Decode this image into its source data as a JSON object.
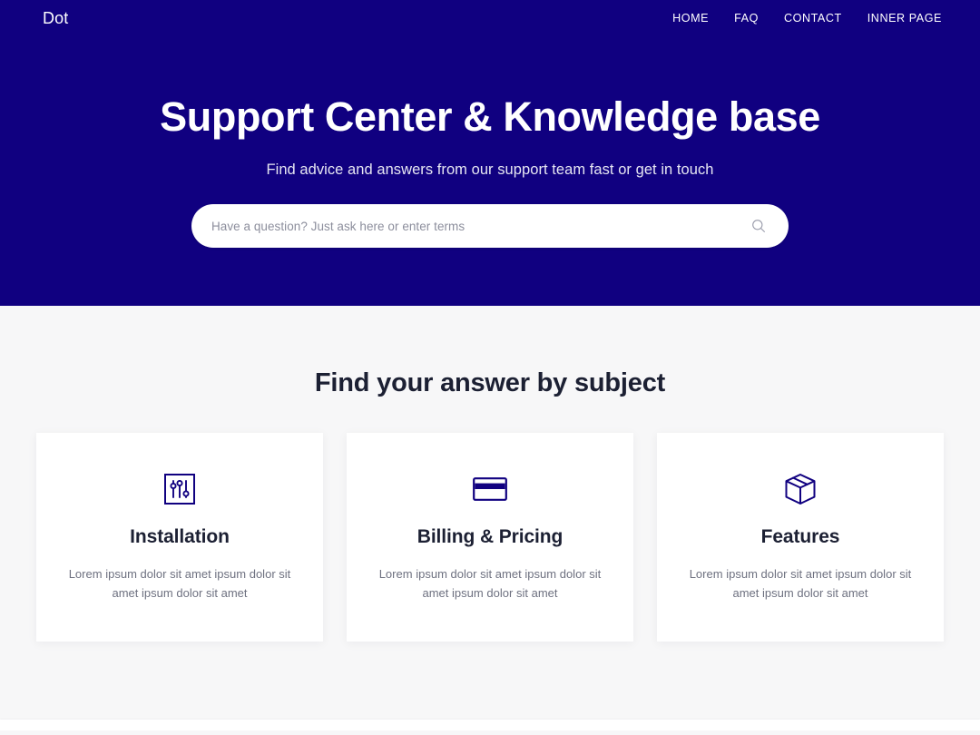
{
  "theme": {
    "hero_bg": "#100080",
    "page_bg": "#f7f7f8",
    "card_bg": "#ffffff",
    "accent": "#100080",
    "heading_color": "#1c2033",
    "muted_text": "#6e7180"
  },
  "navbar": {
    "brand": "Dot",
    "links": [
      {
        "label": "HOME"
      },
      {
        "label": "FAQ"
      },
      {
        "label": "CONTACT"
      },
      {
        "label": "INNER PAGE"
      }
    ]
  },
  "hero": {
    "title": "Support Center & Knowledge base",
    "subtitle": "Find advice and answers from our support team fast or get in touch",
    "search": {
      "value": "",
      "placeholder": "Have a question? Just ask here or enter terms",
      "icon": "search-icon"
    }
  },
  "subjects": {
    "heading": "Find your answer by subject",
    "cards": [
      {
        "icon": "sliders-icon",
        "title": "Installation",
        "text": "Lorem ipsum dolor sit amet ipsum dolor sit amet ipsum dolor sit amet"
      },
      {
        "icon": "credit-card-icon",
        "title": "Billing & Pricing",
        "text": "Lorem ipsum dolor sit amet ipsum dolor sit amet ipsum dolor sit amet"
      },
      {
        "icon": "package-box-icon",
        "title": "Features",
        "text": "Lorem ipsum dolor sit amet ipsum dolor sit amet ipsum dolor sit amet"
      }
    ]
  }
}
